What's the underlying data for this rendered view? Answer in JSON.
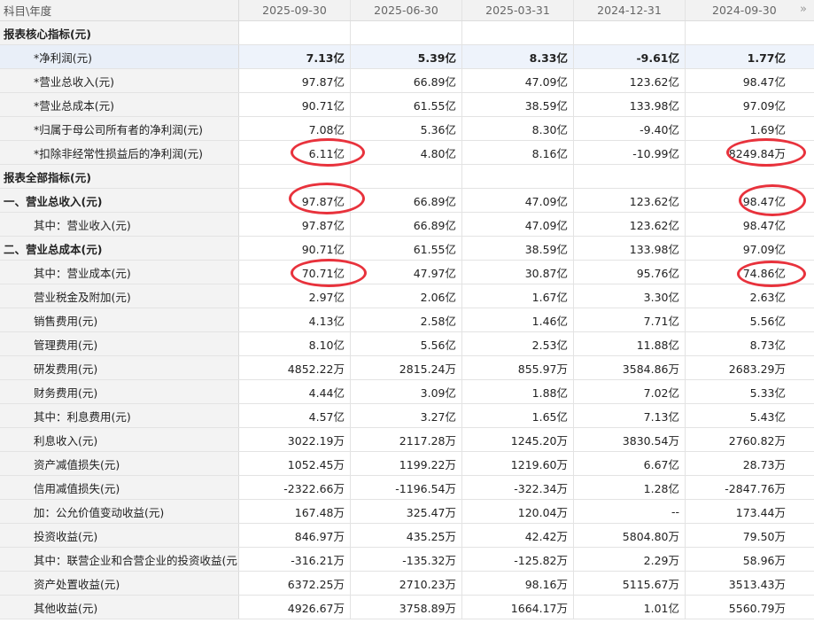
{
  "header": {
    "subject_label": "科目\\年度",
    "dates": [
      "2025-09-30",
      "2025-06-30",
      "2025-03-31",
      "2024-12-31",
      "2024-09-30"
    ],
    "nav_icon": "double-chevron-right-icon"
  },
  "rows": [
    {
      "label": "报表核心指标(元)",
      "level": 0,
      "values": [
        "",
        "",
        "",
        "",
        ""
      ]
    },
    {
      "label": "*净利润(元)",
      "level": 1,
      "highlight": true,
      "bold": true,
      "values": [
        "7.13亿",
        "5.39亿",
        "8.33亿",
        "-9.61亿",
        "1.77亿"
      ]
    },
    {
      "label": "*营业总收入(元)",
      "level": 1,
      "values": [
        "97.87亿",
        "66.89亿",
        "47.09亿",
        "123.62亿",
        "98.47亿"
      ]
    },
    {
      "label": "*营业总成本(元)",
      "level": 1,
      "values": [
        "90.71亿",
        "61.55亿",
        "38.59亿",
        "133.98亿",
        "97.09亿"
      ]
    },
    {
      "label": "*归属于母公司所有者的净利润(元)",
      "level": 1,
      "values": [
        "7.08亿",
        "5.36亿",
        "8.30亿",
        "-9.40亿",
        "1.69亿"
      ]
    },
    {
      "label": "*扣除非经常性损益后的净利润(元)",
      "level": 1,
      "values": [
        "6.11亿",
        "4.80亿",
        "8.16亿",
        "-10.99亿",
        "8249.84万"
      ]
    },
    {
      "label": "报表全部指标(元)",
      "level": 0,
      "values": [
        "",
        "",
        "",
        "",
        ""
      ]
    },
    {
      "label": "一、营业总收入(元)",
      "level": 0,
      "values": [
        "97.87亿",
        "66.89亿",
        "47.09亿",
        "123.62亿",
        "98.47亿"
      ]
    },
    {
      "label": "其中：营业收入(元)",
      "level": 2,
      "values": [
        "97.87亿",
        "66.89亿",
        "47.09亿",
        "123.62亿",
        "98.47亿"
      ]
    },
    {
      "label": "二、营业总成本(元)",
      "level": 0,
      "values": [
        "90.71亿",
        "61.55亿",
        "38.59亿",
        "133.98亿",
        "97.09亿"
      ]
    },
    {
      "label": "其中：营业成本(元)",
      "level": 2,
      "values": [
        "70.71亿",
        "47.97亿",
        "30.87亿",
        "95.76亿",
        "74.86亿"
      ]
    },
    {
      "label": "营业税金及附加(元)",
      "level": 2,
      "values": [
        "2.97亿",
        "2.06亿",
        "1.67亿",
        "3.30亿",
        "2.63亿"
      ]
    },
    {
      "label": "销售费用(元)",
      "level": 2,
      "values": [
        "4.13亿",
        "2.58亿",
        "1.46亿",
        "7.71亿",
        "5.56亿"
      ]
    },
    {
      "label": "管理费用(元)",
      "level": 2,
      "values": [
        "8.10亿",
        "5.56亿",
        "2.53亿",
        "11.88亿",
        "8.73亿"
      ]
    },
    {
      "label": "研发费用(元)",
      "level": 2,
      "values": [
        "4852.22万",
        "2815.24万",
        "855.97万",
        "3584.86万",
        "2683.29万"
      ]
    },
    {
      "label": "财务费用(元)",
      "level": 2,
      "values": [
        "4.44亿",
        "3.09亿",
        "1.88亿",
        "7.02亿",
        "5.33亿"
      ]
    },
    {
      "label": "其中：利息费用(元)",
      "level": 2,
      "values": [
        "4.57亿",
        "3.27亿",
        "1.65亿",
        "7.13亿",
        "5.43亿"
      ]
    },
    {
      "label": "利息收入(元)",
      "level": 2,
      "values": [
        "3022.19万",
        "2117.28万",
        "1245.20万",
        "3830.54万",
        "2760.82万"
      ]
    },
    {
      "label": "资产减值损失(元)",
      "level": 2,
      "values": [
        "1052.45万",
        "1199.22万",
        "1219.60万",
        "6.67亿",
        "28.73万"
      ]
    },
    {
      "label": "信用减值损失(元)",
      "level": 2,
      "values": [
        "-2322.66万",
        "-1196.54万",
        "-322.34万",
        "1.28亿",
        "-2847.76万"
      ]
    },
    {
      "label": "加：公允价值变动收益(元)",
      "level": 2,
      "values": [
        "167.48万",
        "325.47万",
        "120.04万",
        "--",
        "173.44万"
      ]
    },
    {
      "label": "投资收益(元)",
      "level": 2,
      "values": [
        "846.97万",
        "435.25万",
        "42.42万",
        "5804.80万",
        "79.50万"
      ]
    },
    {
      "label": "其中：联营企业和合营企业的投资收益(元)",
      "level": 2,
      "values": [
        "-316.21万",
        "-135.32万",
        "-125.82万",
        "2.29万",
        "58.96万"
      ]
    },
    {
      "label": "资产处置收益(元)",
      "level": 2,
      "values": [
        "6372.25万",
        "2710.23万",
        "98.16万",
        "5115.67万",
        "3513.43万"
      ]
    },
    {
      "label": "其他收益(元)",
      "level": 2,
      "values": [
        "4926.67万",
        "3758.89万",
        "1664.17万",
        "1.01亿",
        "5560.79万"
      ]
    }
  ],
  "annotations": {
    "circle_color": "#e8323c"
  }
}
